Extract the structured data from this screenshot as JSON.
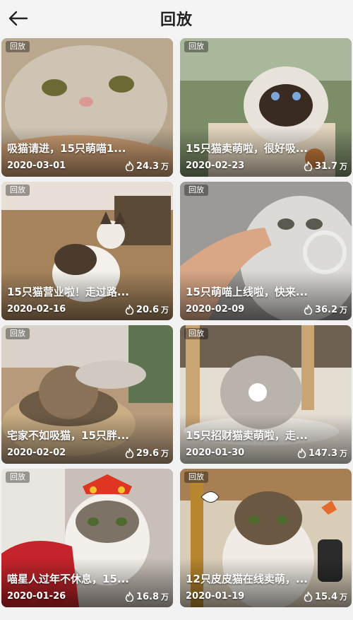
{
  "header": {
    "title": "回放"
  },
  "badge_label": "回放",
  "view_unit": "万",
  "cards": [
    {
      "title": "吸猫请进，15只萌喵1...",
      "date": "2020-03-01",
      "views": "24.3",
      "palette": [
        "#b9a88e",
        "#cfc4b4",
        "#6f6150"
      ]
    },
    {
      "title": "15只猫卖萌啦，很好吸...",
      "date": "2020-02-23",
      "views": "31.7",
      "palette": [
        "#7c8e68",
        "#e8e3da",
        "#3a2b22"
      ]
    },
    {
      "title": "15只猫营业啦！走过路...",
      "date": "2020-02-16",
      "views": "20.6",
      "palette": [
        "#a5835c",
        "#f4f1ec",
        "#4a3b2e"
      ]
    },
    {
      "title": "15只萌喵上线啦，快来...",
      "date": "2020-02-09",
      "views": "36.2",
      "palette": [
        "#9c9a97",
        "#dcdad6",
        "#7a6a5a"
      ]
    },
    {
      "title": "宅家不如吸猫，15只胖...",
      "date": "2020-02-02",
      "views": "29.6",
      "palette": [
        "#b69a7b",
        "#6c5a44",
        "#3c3026"
      ]
    },
    {
      "title": "15只招财猫卖萌啦，走...",
      "date": "2020-01-30",
      "views": "147.3",
      "palette": [
        "#c9a574",
        "#e7e2dc",
        "#8a7d6f"
      ]
    },
    {
      "title": "喵星人过年不休息，15...",
      "date": "2020-01-26",
      "views": "16.8",
      "palette": [
        "#c8c0b8",
        "#f3efea",
        "#c4242a"
      ]
    },
    {
      "title": "12只皮皮猫在线卖萌，...",
      "date": "2020-01-19",
      "views": "15.4",
      "palette": [
        "#b7862e",
        "#f0ebe4",
        "#6b5842"
      ]
    }
  ]
}
